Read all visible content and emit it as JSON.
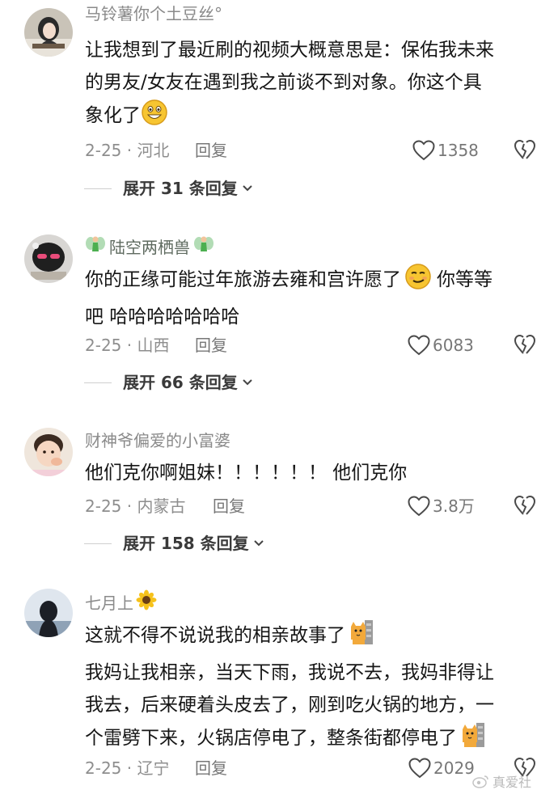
{
  "comments": [
    {
      "username": "马铃薯你个土豆丝°",
      "lines": [
        "让我想到了最近刷的视频大概意思是：保佑我未来",
        "的男友/女友在遇到我之前谈不到对象。你这个具",
        "象化了"
      ],
      "date_location": "2-25 · 河北",
      "reply_label": "回复",
      "likes": "1358",
      "expand_label": "展开 31 条回复"
    },
    {
      "username": "陆空两栖兽",
      "lines": [
        "你的正缘可能过年旅游去雍和宫许愿了",
        "吧 哈哈哈哈哈哈哈"
      ],
      "line1_tail": "你等等",
      "date_location": "2-25 · 山西",
      "reply_label": "回复",
      "likes": "6083",
      "expand_label": "展开 66 条回复"
    },
    {
      "username": "财神爷偏爱的小富婆",
      "lines": [
        "他们克你啊姐妹！！！！！！ 他们克你"
      ],
      "date_location": "2-25 · 内蒙古",
      "reply_label": "回复",
      "likes": "3.8万",
      "expand_label": "展开 158 条回复"
    },
    {
      "username": "七月上",
      "lines": [
        "这就不得不说说我的相亲故事了",
        "我妈让我相亲，当天下雨，我说不去，我妈非得让",
        "我去，后来硬着头皮去了，刚到吃火锅的地方，一",
        "个雷劈下来，火锅店停电了，整条街都停电了"
      ],
      "date_location": "2-25 · 辽宁",
      "reply_label": "回复",
      "likes": "2029"
    }
  ],
  "watermark": "真爱社",
  "icons": {
    "like": "heart-outline-icon",
    "dislike": "broken-heart-icon",
    "expand": "chevron-down-icon",
    "emoji_1": "grinning-emoji",
    "emoji_2": "smirking-emoji",
    "sticker": "cat-sticker-emoji",
    "sunflower": "sunflower-emoji",
    "fairy": "fairy-emoji"
  },
  "colors": {
    "text": "#161616",
    "meta": "#8e8e8e",
    "username": "#8a8a8a",
    "emoji_yellow": "#f7c531"
  }
}
